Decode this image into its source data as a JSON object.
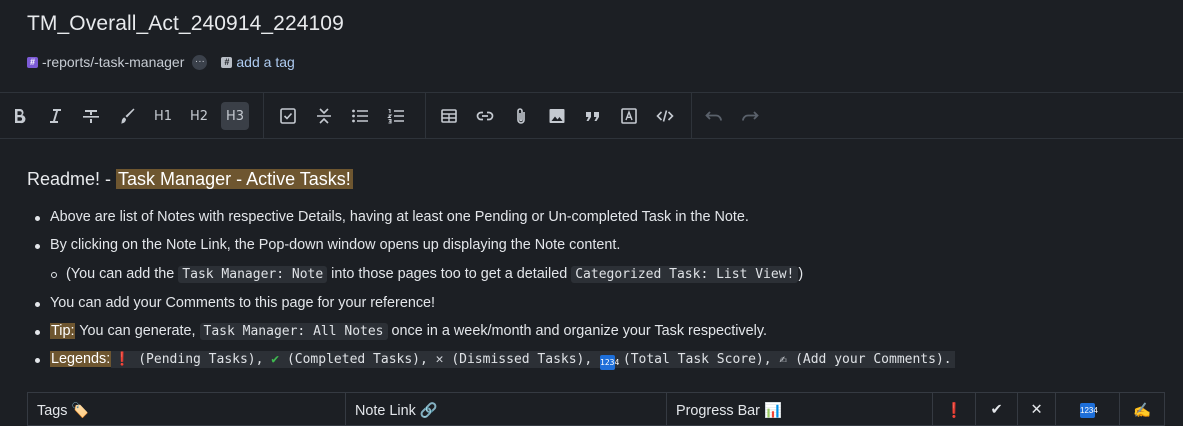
{
  "note": {
    "title": "TM_Overall_Act_240914_224109",
    "tag": "-reports/-task-manager",
    "more_label": "···",
    "add_tag_label": "add a tag"
  },
  "toolbar": {
    "h1": "H1",
    "h2": "H2",
    "h3": "H3"
  },
  "body": {
    "heading_prefix": "Readme! - ",
    "heading_highlight": "Task Manager - Active Tasks!",
    "bullet1": "Above are list of Notes with respective Details, having at least one Pending or Un-completed Task in the Note.",
    "bullet2": "By clicking on the Note Link, the Pop-down window opens up displaying the Note content.",
    "sub_a": "(You can add the ",
    "sub_code1": "Task Manager: Note",
    "sub_b": " into those pages too to get a detailed ",
    "sub_code2": "Categorized Task: List View!",
    "sub_c": ")",
    "bullet3": "You can add your Comments to this page for your reference!",
    "tip_label": "Tip:",
    "tip_a": " You can generate, ",
    "tip_code": "Task Manager: All Notes",
    "tip_b": " once in a week/month and organize your Task respectively.",
    "legend_label": "Legends:",
    "legend_pending": "❗",
    "legend_pending_text": " (Pending Tasks), ",
    "legend_completed": "✔",
    "legend_completed_text": " (Completed Tasks), ",
    "legend_dismissed": "✕",
    "legend_dismissed_text": " (Dismissed Tasks), ",
    "legend_score": "🔢",
    "legend_score_text": " (Total Task Score), ",
    "legend_comment": "✍",
    "legend_comment_text": " (Add your Comments)."
  },
  "table": {
    "col_tags": "Tags 🏷️",
    "col_note_link": "Note Link 🔗",
    "col_progress": "Progress Bar 📊",
    "col_pending": "❗",
    "col_completed": "✔",
    "col_dismissed": "✕",
    "col_score": "🔢",
    "col_comment": "✍"
  },
  "colors": {
    "background": "#1c1f24",
    "highlight": "#6e5630",
    "link": "#aecbf0",
    "tag_hash": "#7c5bd6"
  }
}
